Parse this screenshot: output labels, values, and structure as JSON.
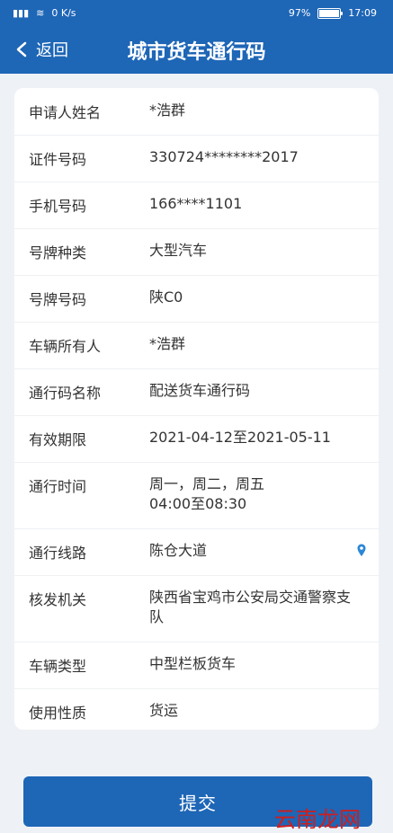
{
  "status": {
    "network": "0 K/s",
    "battery_percent": "97%",
    "time": "17:09"
  },
  "header": {
    "back_label": "返回",
    "title": "城市货车通行码"
  },
  "form": {
    "rows": [
      {
        "label": "申请人姓名",
        "value": "*浩群"
      },
      {
        "label": "证件号码",
        "value": "330724********2017"
      },
      {
        "label": "手机号码",
        "value": "166****1101"
      },
      {
        "label": "号牌种类",
        "value": "大型汽车"
      },
      {
        "label": "号牌号码",
        "value": "陕C0"
      },
      {
        "label": "车辆所有人",
        "value": "*浩群"
      },
      {
        "label": "通行码名称",
        "value": "配送货车通行码"
      },
      {
        "label": "有效期限",
        "value": "2021-04-12至2021-05-11"
      },
      {
        "label": "通行时间",
        "value": "周一，周二，周五\n04:00至08:30"
      },
      {
        "label": "通行线路",
        "value": "陈仓大道"
      },
      {
        "label": "核发机关",
        "value": "陕西省宝鸡市公安局交通警察支队"
      },
      {
        "label": "车辆类型",
        "value": "中型栏板货车"
      },
      {
        "label": "使用性质",
        "value": "货运"
      }
    ]
  },
  "submit_label": "提交",
  "watermark": "云南龙网",
  "colors": {
    "brand_blue": "#1e66b6",
    "watermark_red": "#cf1d1d",
    "pin_blue": "#2b86d6"
  }
}
